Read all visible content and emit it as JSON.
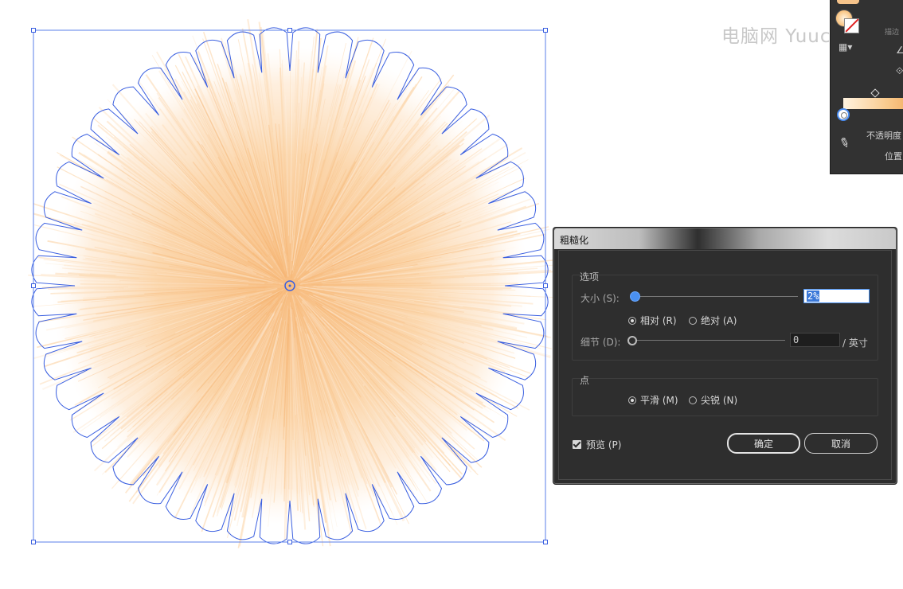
{
  "watermark": "电脑网 Yuucn.com",
  "side_panel": {
    "stroke_label": "描边",
    "opacity_label": "不透明度",
    "position_label": "位置"
  },
  "dialog": {
    "title": "粗糙化",
    "options_group": "选项",
    "size_label": "大小 (S):",
    "size_value": "2%",
    "relative_label": "相对 (R)",
    "absolute_label": "绝对 (A)",
    "detail_label": "细节 (D):",
    "detail_value": "0",
    "detail_unit": "/ 英寸",
    "points_group": "点",
    "smooth_label": "平滑 (M)",
    "corner_label": "尖锐 (N)",
    "preview_label": "预览 (P)",
    "ok_label": "确定",
    "cancel_label": "取消",
    "size_slider_level": 0,
    "detail_slider_level": 0,
    "relative_selected": true,
    "smooth_selected": true,
    "preview_checked": true
  },
  "colors": {
    "fill_orange": "#f9c98b",
    "selection_blue": "#3a5fe0",
    "dialog_bg": "#2e2e2e"
  }
}
